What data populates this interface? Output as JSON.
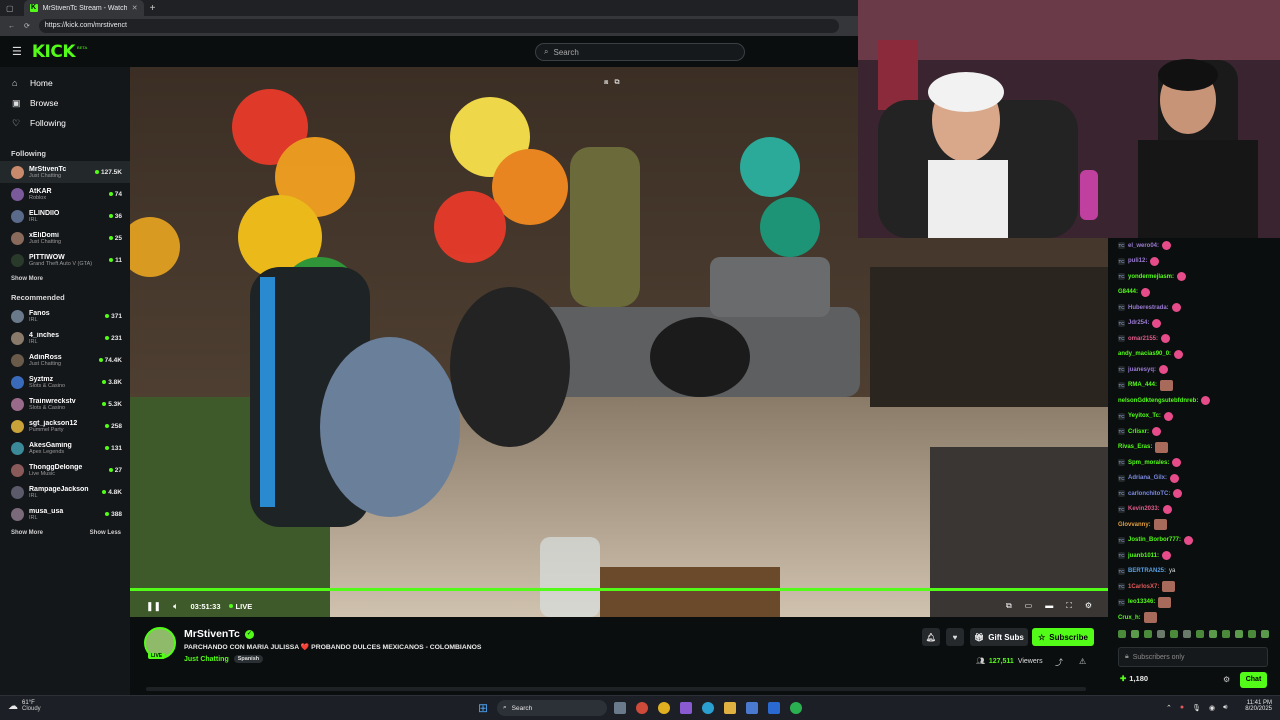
{
  "browser": {
    "tab_title": "MrStivenTc Stream - Watch ...",
    "new_tab": "+",
    "url": "https://kick.com/mrstivenct"
  },
  "header": {
    "logo": "KICK",
    "logo_beta": "BETA",
    "search_placeholder": "Search"
  },
  "sidebar": {
    "nav": [
      {
        "label": "Home",
        "icon": "home-icon"
      },
      {
        "label": "Browse",
        "icon": "browse-icon"
      },
      {
        "label": "Following",
        "icon": "heart-icon"
      }
    ],
    "following_title": "Following",
    "following": [
      {
        "name": "MrStivenTc",
        "category": "Just Chatting",
        "viewers": "127.5K",
        "color": "#c98a6c"
      },
      {
        "name": "AtKAR",
        "category": "Roblox",
        "viewers": "74",
        "color": "#7a5a9a"
      },
      {
        "name": "ELINDIIO",
        "category": "IRL",
        "viewers": "36",
        "color": "#5a6a8a"
      },
      {
        "name": "xEliDomi",
        "category": "Just Chatting",
        "viewers": "25",
        "color": "#8a6a5a"
      },
      {
        "name": "PITTIWOW",
        "category": "Grand Theft Auto V (GTA)",
        "viewers": "11",
        "color": "#2a3a2a"
      }
    ],
    "following_show_more": "Show More",
    "recommended_title": "Recommended",
    "recommended": [
      {
        "name": "Fanos",
        "category": "IRL",
        "viewers": "371",
        "color": "#6a7a8a"
      },
      {
        "name": "4_inches",
        "category": "IRL",
        "viewers": "231",
        "color": "#8a7a6a"
      },
      {
        "name": "AdinRoss",
        "category": "Just Chatting",
        "viewers": "74.4K",
        "color": "#6a5a4a"
      },
      {
        "name": "Syztmz",
        "category": "Slots & Casino",
        "viewers": "3.8K",
        "color": "#3a6aba"
      },
      {
        "name": "Trainwreckstv",
        "category": "Slots & Casino",
        "viewers": "5.3K",
        "color": "#9a6a8a"
      },
      {
        "name": "sgt_jackson12",
        "category": "Pummel Party",
        "viewers": "258",
        "color": "#caa23a"
      },
      {
        "name": "AkesGaming",
        "category": "Apex Legends",
        "viewers": "131",
        "color": "#3a8a9a"
      },
      {
        "name": "ThonggDelonge",
        "category": "Live Music",
        "viewers": "27",
        "color": "#8a5a5a"
      },
      {
        "name": "RampageJackson",
        "category": "IRL",
        "viewers": "4.8K",
        "color": "#5a5a6a"
      },
      {
        "name": "musa_usa",
        "category": "IRL",
        "viewers": "388",
        "color": "#7a6a7a"
      }
    ],
    "show_more": "Show More",
    "show_less": "Show Less"
  },
  "player": {
    "time": "03:51:33",
    "live": "LIVE"
  },
  "stream": {
    "channel": "MrStivenTc",
    "avatar_live": "LIVE",
    "title": "PARCHANDO CON MARIA JULISSA ❤️ PROBANDO DULCES MEXICANOS - COLOMBIANOS",
    "category": "Just Chatting",
    "tag": "Spanish",
    "viewers": "127,511",
    "viewers_label": "Viewers",
    "gift_subs": "Gift Subs",
    "subscribe": "Subscribe"
  },
  "chat": {
    "messages": [
      {
        "user": "el_wero04:",
        "color": "#9b7bd4",
        "badge": true,
        "emote": "heart"
      },
      {
        "user": "puli12:",
        "color": "#9b7bd4",
        "badge": true,
        "emote": "heart"
      },
      {
        "user": "yondermejlasm:",
        "color": "#53fc18",
        "badge": true,
        "emote": "heart"
      },
      {
        "user": "G8444:",
        "color": "#53fc18",
        "badge": false,
        "emote": "heart"
      },
      {
        "user": "Huberestrada:",
        "color": "#9b7bd4",
        "badge": true,
        "emote": "heart"
      },
      {
        "user": "Jdr254:",
        "color": "#9b7bd4",
        "badge": true,
        "emote": "heart"
      },
      {
        "user": "omar2155:",
        "color": "#e05a8a",
        "badge": true,
        "emote": "heart"
      },
      {
        "user": "andy_macias90_0:",
        "color": "#53fc18",
        "badge": false,
        "emote": "heart"
      },
      {
        "user": "juanesyq:",
        "color": "#9b7bd4",
        "badge": true,
        "emote": "heart"
      },
      {
        "user": "RMA_444:",
        "color": "#53fc18",
        "badge": true,
        "emote": "img"
      },
      {
        "user": "nelsonGdktengsutebfdnreb:",
        "color": "#53fc18",
        "badge": false,
        "emote": "heart"
      },
      {
        "user": "Yeyitox_Tc:",
        "color": "#53fc18",
        "badge": true,
        "emote": "heart"
      },
      {
        "user": "Crlisxr:",
        "color": "#53fc18",
        "badge": true,
        "emote": "heart"
      },
      {
        "user": "Rivas_Eras:",
        "color": "#53fc18",
        "badge": false,
        "emote": "img"
      },
      {
        "user": "Spm_morales:",
        "color": "#53fc18",
        "badge": true,
        "emote": "heart"
      },
      {
        "user": "Adriana_Gilx:",
        "color": "#7a8ae0",
        "badge": true,
        "emote": "heart"
      },
      {
        "user": "carlonchitoTC:",
        "color": "#7a8ae0",
        "badge": true,
        "emote": "heart"
      },
      {
        "user": "Kevin2033:",
        "color": "#e05a8a",
        "badge": true,
        "emote": "heart"
      },
      {
        "user": "Glovvanny:",
        "color": "#e0a040",
        "badge": false,
        "emote": "img"
      },
      {
        "user": "Jostin_Borbor777:",
        "color": "#53fc18",
        "badge": true,
        "emote": "heart"
      },
      {
        "user": "juanb1011:",
        "color": "#53fc18",
        "badge": true,
        "emote": "heart"
      },
      {
        "user": "BERTRAN25:",
        "color": "#5aa0e0",
        "badge": true,
        "text": "ya"
      },
      {
        "user": "1CarlosX7:",
        "color": "#e05a5a",
        "badge": true,
        "emote": "img"
      },
      {
        "user": "leo13346:",
        "color": "#53fc18",
        "badge": true,
        "emote": "img"
      },
      {
        "user": "Crux_h:",
        "color": "#53fc18",
        "badge": false,
        "emote": "img"
      }
    ],
    "input_placeholder": "Subscribers only",
    "points": "1,180",
    "chat_button": "Chat"
  },
  "taskbar": {
    "weather_temp": "61°F",
    "weather_desc": "Cloudy",
    "search": "Search",
    "time": "11:41 PM",
    "date": "8/20/2025"
  }
}
